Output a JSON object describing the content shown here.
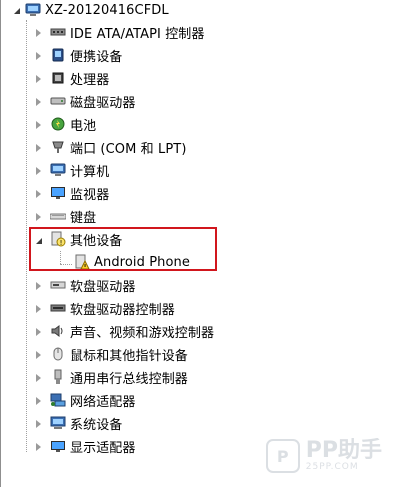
{
  "computer_name": "XZ-20120416CFDL",
  "categories": [
    {
      "label": "IDE ATA/ATAPI 控制器",
      "icon": "ide-controller-icon"
    },
    {
      "label": "便携设备",
      "icon": "portable-device-icon"
    },
    {
      "label": "处理器",
      "icon": "processor-icon"
    },
    {
      "label": "磁盘驱动器",
      "icon": "disk-drive-icon"
    },
    {
      "label": "电池",
      "icon": "battery-icon"
    },
    {
      "label": "端口 (COM 和 LPT)",
      "icon": "port-icon"
    },
    {
      "label": "计算机",
      "icon": "computer-icon"
    },
    {
      "label": "监视器",
      "icon": "monitor-icon"
    },
    {
      "label": "键盘",
      "icon": "keyboard-icon"
    },
    {
      "label": "其他设备",
      "icon": "other-devices-icon",
      "expanded": true,
      "children": [
        {
          "label": "Android Phone",
          "icon": "unknown-device-warning-icon"
        }
      ]
    },
    {
      "label": "软盘驱动器",
      "icon": "floppy-drive-icon"
    },
    {
      "label": "软盘驱动器控制器",
      "icon": "floppy-controller-icon"
    },
    {
      "label": "声音、视频和游戏控制器",
      "icon": "sound-icon"
    },
    {
      "label": "鼠标和其他指针设备",
      "icon": "mouse-icon"
    },
    {
      "label": "通用串行总线控制器",
      "icon": "usb-icon"
    },
    {
      "label": "网络适配器",
      "icon": "network-adapter-icon"
    },
    {
      "label": "系统设备",
      "icon": "system-device-icon"
    },
    {
      "label": "显示适配器",
      "icon": "display-adapter-icon"
    }
  ],
  "watermark": {
    "main": "PP助手",
    "sub": "25PP.COM",
    "badge": "P"
  }
}
